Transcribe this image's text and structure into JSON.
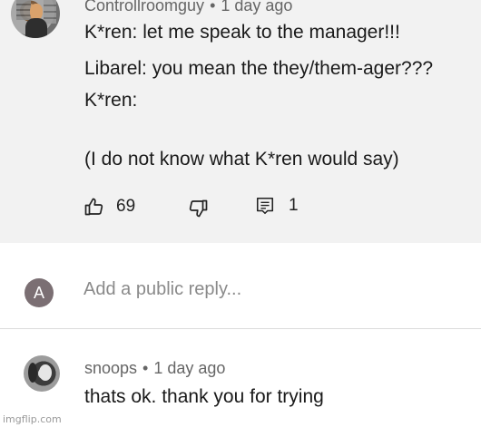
{
  "comment1": {
    "author": "Controllroomguy",
    "separator": "•",
    "time": "1 day ago",
    "lines": [
      "K*ren: let me speak to the manager!!!",
      "Libarel: you mean the they/them-ager???",
      "K*ren:",
      "(I do not know what K*ren would say)"
    ],
    "like_count": "69",
    "reply_count": "1",
    "icons": {
      "like": "thumbs-up-icon",
      "dislike": "thumbs-down-icon",
      "reply": "comment-icon"
    }
  },
  "reply_box": {
    "avatar_letter": "A",
    "placeholder": "Add a public reply..."
  },
  "comment2": {
    "author": "snoops",
    "separator": "•",
    "time": "1 day ago",
    "text": "thats ok. thank you for trying"
  },
  "watermark": "imgflip.com",
  "colors": {
    "comment_bg": "#f2f2f2",
    "meta_text": "#666666",
    "avatar_a_bg": "#7b6f73"
  }
}
